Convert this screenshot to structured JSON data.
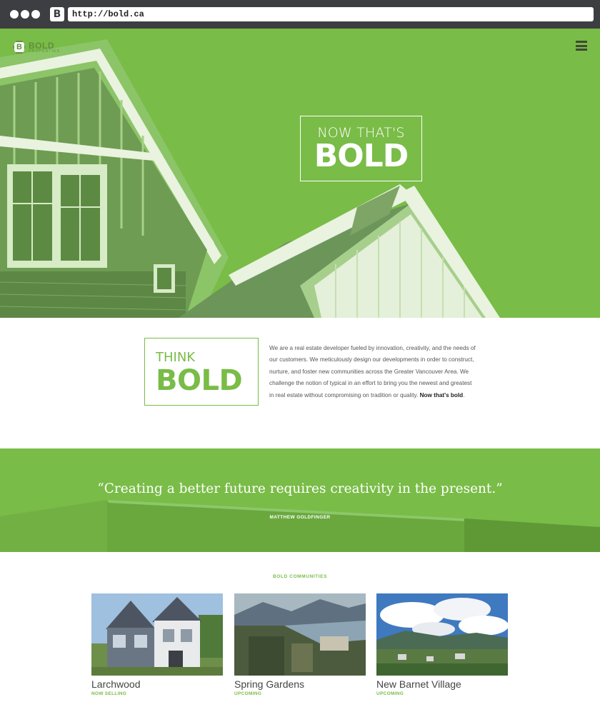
{
  "browser": {
    "favicon_letter": "B",
    "url": "http://bold.ca"
  },
  "header": {
    "logo_letter": "B",
    "logo_text": "BOLD",
    "logo_subtext": "PROPERTIES",
    "menu_icon": "hamburger-menu-icon"
  },
  "hero": {
    "line1": "NOW THAT'S",
    "line2": "BOLD"
  },
  "about": {
    "heading_line1": "THINK",
    "heading_line2": "BOLD",
    "body": "We are a real estate developer fueled by innovation, creativity, and the needs of our customers. We meticulously design our developments in order to construct, nurture, and foster new communities across the Greater Vancouver Area. We challenge the notion of typical in an effort to bring you the newest and greatest in real estate without compromising on tradition or quality.",
    "tagline": "Now that's bold",
    "tagline_end": "."
  },
  "quote": {
    "text": "“Creating a better future requires creativity in the present.”",
    "author": "MATTHEW GOLDFINGER"
  },
  "communities": {
    "title": "BOLD COMMUNITIES",
    "items": [
      {
        "name": "Larchwood",
        "status": "NOW SELLING"
      },
      {
        "name": "Spring Gardens",
        "status": "UPCOMING"
      },
      {
        "name": "New Barnet Village",
        "status": "UPCOMING"
      }
    ]
  },
  "colors": {
    "brand_green": "#79bc47",
    "chrome": "#3d3e42"
  }
}
